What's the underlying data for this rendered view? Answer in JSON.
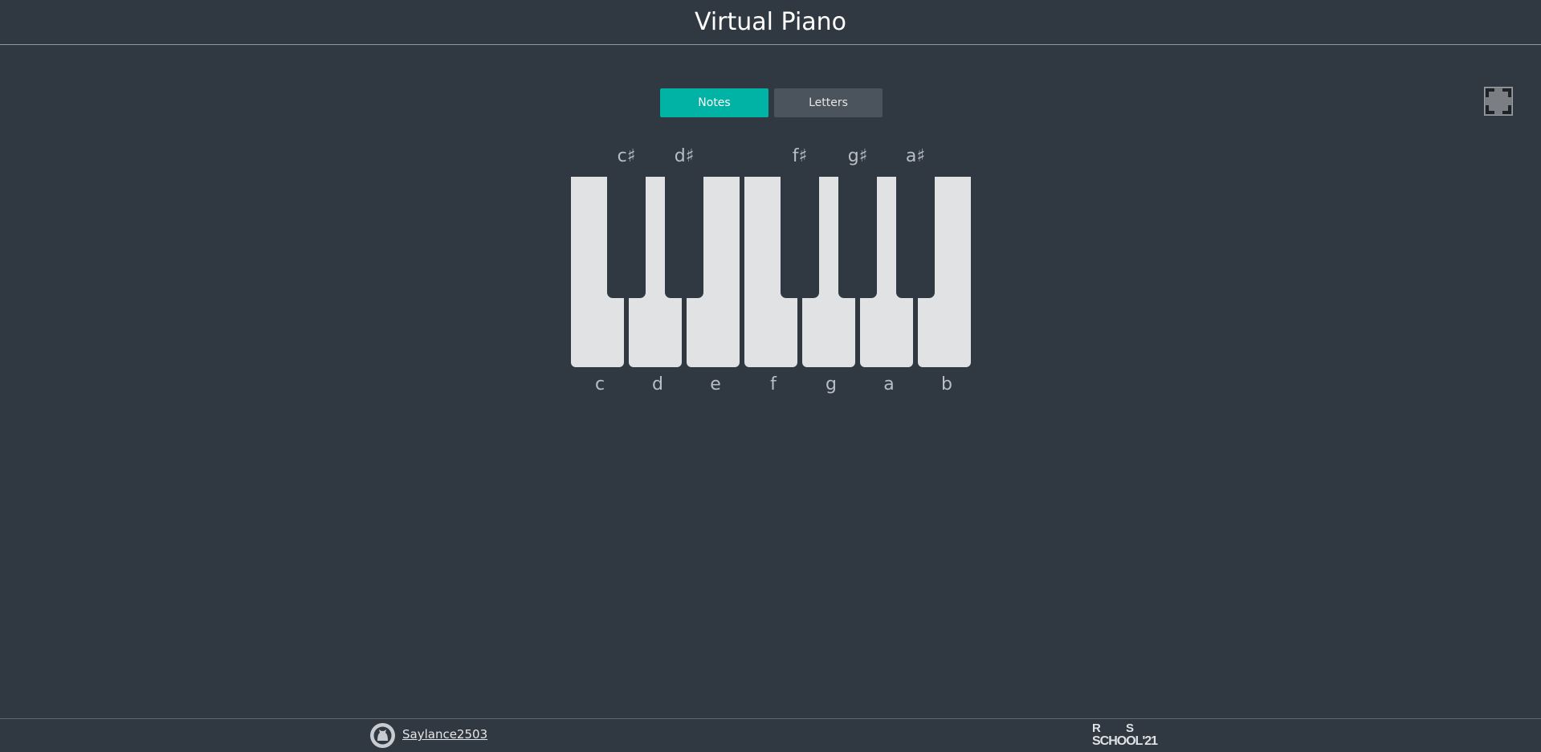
{
  "header": {
    "title": "Virtual Piano"
  },
  "controls": {
    "notes_label": "Notes",
    "letters_label": "Letters",
    "active": "Notes",
    "accent_color": "#00b3a4"
  },
  "fullscreen": {
    "icon": "fullscreen-icon"
  },
  "piano": {
    "white_keys": [
      {
        "note": "c"
      },
      {
        "note": "d"
      },
      {
        "note": "e"
      },
      {
        "note": "f"
      },
      {
        "note": "g"
      },
      {
        "note": "a"
      },
      {
        "note": "b"
      }
    ],
    "black_keys": [
      {
        "note": "c♯"
      },
      {
        "note": "d♯"
      },
      {
        "note": "f♯"
      },
      {
        "note": "g♯"
      },
      {
        "note": "a♯"
      }
    ]
  },
  "footer": {
    "github_icon": "github-icon",
    "author": "Saylance2503",
    "logo_text_line1_a": "R",
    "logo_text_line1_b": "S",
    "logo_text_line2": "SCHOOL'21"
  }
}
